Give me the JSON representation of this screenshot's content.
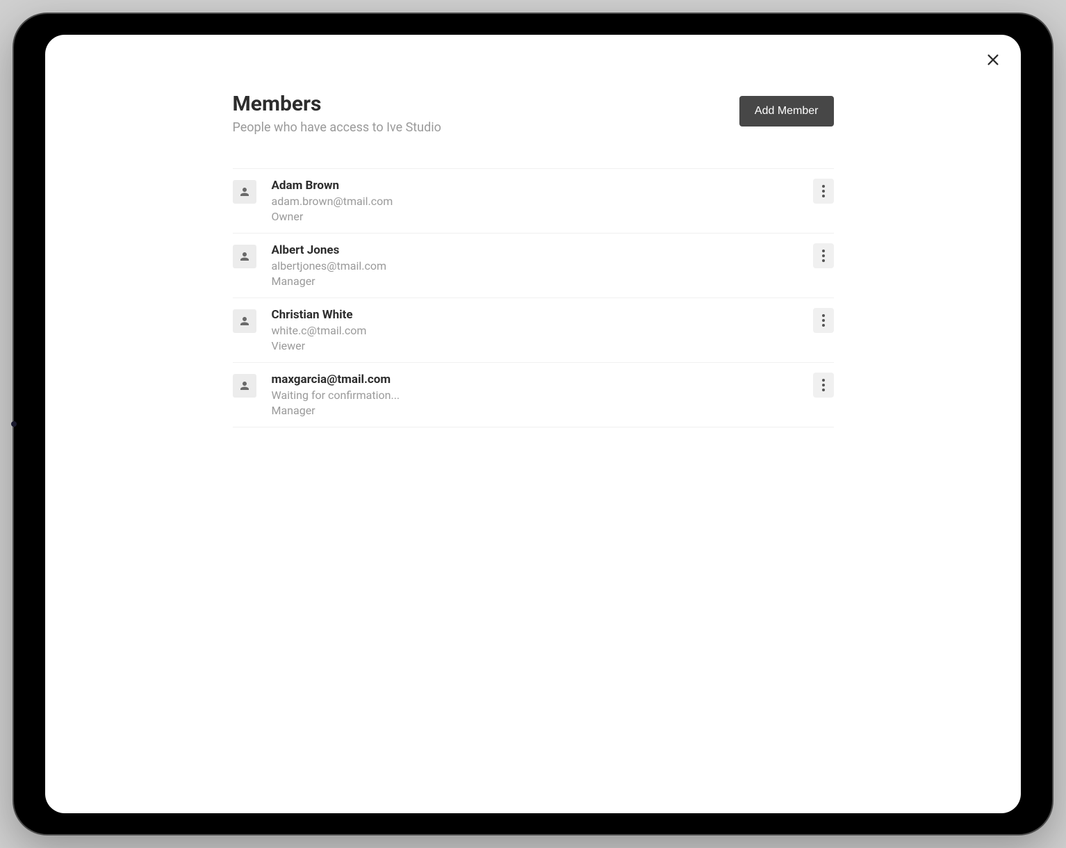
{
  "header": {
    "title": "Members",
    "subtitle": "People who have access to Ive Studio",
    "add_button_label": "Add Member"
  },
  "members": [
    {
      "name": "Adam Brown",
      "sub": "adam.brown@tmail.com",
      "role": "Owner"
    },
    {
      "name": "Albert Jones",
      "sub": "albertjones@tmail.com",
      "role": "Manager"
    },
    {
      "name": "Christian White",
      "sub": "white.c@tmail.com",
      "role": "Viewer"
    },
    {
      "name": "maxgarcia@tmail.com",
      "sub": "Waiting for confirmation...",
      "role": "Manager"
    }
  ]
}
